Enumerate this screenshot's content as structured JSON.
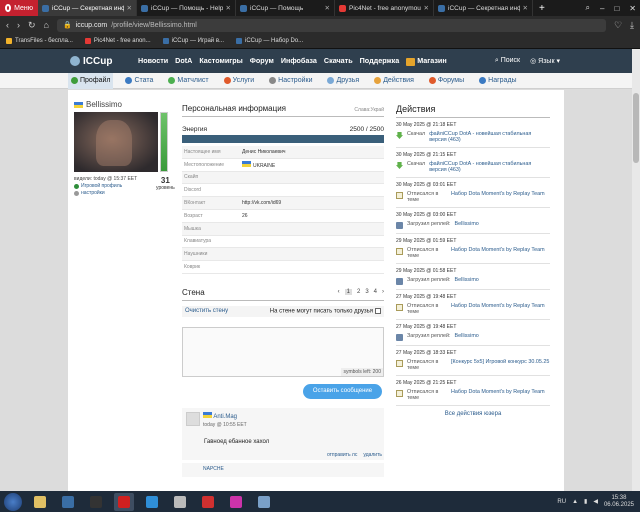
{
  "browser": {
    "menu_label": "Меню",
    "tabs": [
      {
        "title": "iCCup — Секретная инфо",
        "active": true,
        "color": "#3a6ea5"
      },
      {
        "title": "iCCup — Помощь - Help",
        "active": false,
        "color": "#3a6ea5"
      },
      {
        "title": "iCCup — Помощь",
        "active": false,
        "color": "#3a6ea5"
      },
      {
        "title": "Pic4Net - free anonymou",
        "active": false,
        "color": "#e53935"
      },
      {
        "title": "iCCup — Секретная инфо",
        "active": false,
        "color": "#3a6ea5"
      }
    ],
    "url_host": "iccup.com",
    "url_path": "/profile/view/Bellissimo.html",
    "bookmarks": [
      {
        "label": "TransFiles - беспла...",
        "color": "#f3b32b"
      },
      {
        "label": "Pic4Net - free anon...",
        "color": "#e53935"
      },
      {
        "label": "iCCup — Играй в...",
        "color": "#3a6ea5"
      },
      {
        "label": "iCCup — Набор Do...",
        "color": "#3a6ea5"
      }
    ]
  },
  "site": {
    "brand": "ICCup",
    "nav": [
      "Новости",
      "DotA",
      "Кастомигры",
      "Форум",
      "Инфобаза",
      "Скачать",
      "Поддержка"
    ],
    "shop": "Магазин",
    "search": "Поиск",
    "lang": "Язык",
    "subnav": [
      {
        "label": "Профайл",
        "active": true,
        "color": "#3f9d3a"
      },
      {
        "label": "Стата",
        "active": false,
        "color": "#3b7ac2"
      },
      {
        "label": "Матчлист",
        "active": false,
        "color": "#4caf50"
      },
      {
        "label": "Услуги",
        "active": false,
        "color": "#e05a2b"
      },
      {
        "label": "Настройки",
        "active": false,
        "color": "#888888"
      },
      {
        "label": "Друзья",
        "active": false,
        "color": "#7aa9d6"
      },
      {
        "label": "Действия",
        "active": false,
        "color": "#e6a23c"
      },
      {
        "label": "Форумы",
        "active": false,
        "color": "#e05a2b"
      },
      {
        "label": "Награды",
        "active": false,
        "color": "#3b7ac2"
      }
    ]
  },
  "profile": {
    "username": "Bellissimo",
    "seen": "видели: today @ 15:37 EET",
    "game_profile": "Игровой профиль",
    "settings": "настройки",
    "level": "31",
    "level_label": "уровень",
    "energy_fraction": 1.0
  },
  "personal": {
    "title": "Персональная информация",
    "glory": "Слава:Украй",
    "energy_label": "Энергия",
    "energy_value": "2500 / 2500",
    "rows": [
      {
        "k": "Настоящее имя",
        "v": "Денис Николаевич"
      },
      {
        "k": "Местоположение",
        "v": "UKRAINE"
      },
      {
        "k": "Скайп",
        "v": ""
      },
      {
        "k": "Discord",
        "v": ""
      },
      {
        "k": "ВКонтакт",
        "v": "http://vk.com/id69"
      },
      {
        "k": "Возраст",
        "v": "26"
      },
      {
        "k": "Мышка",
        "v": ""
      },
      {
        "k": "Клавиатура",
        "v": ""
      },
      {
        "k": "Наушники",
        "v": ""
      },
      {
        "k": "Коврик",
        "v": ""
      }
    ]
  },
  "wall": {
    "title": "Стена",
    "pages": [
      "‹",
      "1",
      "2",
      "3",
      "4",
      "›"
    ],
    "clear": "Очистить стену",
    "only_friends": "На стене могут писать только друзья",
    "symbols_left": "symbols left: 200",
    "send": "Оставить сообщение",
    "post": {
      "author": "Anti.Mag",
      "time": "today @ 10:55 EET",
      "text": "Гавноед ебанное хахол",
      "reply": "отправить лс",
      "delete": "удалить"
    },
    "post2_author": "NAPCHE"
  },
  "actions": {
    "title": "Действия",
    "all": "Все действия юзера",
    "items": [
      {
        "date": "30 May 2025 @ 21:18 EET",
        "icon": "dl",
        "label": "Скачал",
        "text": "файлiCCup DotA - новейшая стабильная версия (463)"
      },
      {
        "date": "30 May 2025 @ 21:15 EET",
        "icon": "dl",
        "label": "Скачал",
        "text": "файлiCCup DotA - новейшая стабильная версия (463)"
      },
      {
        "date": "30 May 2025 @ 03:01 EET",
        "icon": "doc",
        "label": "Отписался в теме",
        "text": "Набор Dota Moment's by Replay Team"
      },
      {
        "date": "30 May 2025 @ 03:00 EET",
        "icon": "rep",
        "label": "Загрузил реплей:",
        "text": "Bellissimo"
      },
      {
        "date": "29 May 2025 @ 01:59 EET",
        "icon": "doc",
        "label": "Отписался в теме",
        "text": "Набор Dota Moment's by Replay Team"
      },
      {
        "date": "29 May 2025 @ 01:58 EET",
        "icon": "rep",
        "label": "Загрузил реплей:",
        "text": "Bellissimo"
      },
      {
        "date": "27 May 2025 @ 19:48 EET",
        "icon": "doc",
        "label": "Отписался в теме",
        "text": "Набор Dota Moment's by Replay Team"
      },
      {
        "date": "27 May 2025 @ 19:48 EET",
        "icon": "rep",
        "label": "Загрузил реплей:",
        "text": "Bellissimo"
      },
      {
        "date": "27 May 2025 @ 18:33 EET",
        "icon": "doc",
        "label": "Отписался в теме",
        "text": "[Конкурс 5х5] Игровой конкурс 30.05.25"
      },
      {
        "date": "26 May 2025 @ 21:25 EET",
        "icon": "doc",
        "label": "Отписался в теме",
        "text": "Набор Dota Moment's by Replay Team"
      }
    ]
  },
  "taskbar": {
    "apps": [
      "#e0c064",
      "#3a6ea5",
      "#333333",
      "#d02020",
      "#2f8fd8",
      "#bbbbbb",
      "#d03030",
      "#cc33aa",
      "#7aa0c8"
    ],
    "lang": "RU",
    "time": "15:38",
    "date": "06.06.2025"
  }
}
